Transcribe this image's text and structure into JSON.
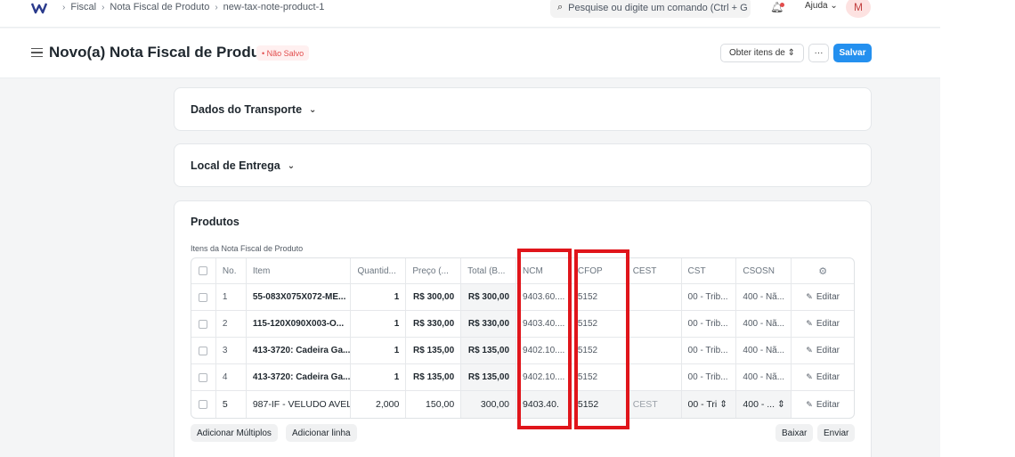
{
  "breadcrumbs": [
    "Fiscal",
    "Nota Fiscal de Produto",
    "new-tax-note-product-1"
  ],
  "search": {
    "placeholder": "Pesquise ou digite um comando (Ctrl + G"
  },
  "navbar": {
    "help_label": "Ajuda",
    "avatar_initial": "M"
  },
  "page": {
    "title": "Novo(a) Nota Fiscal de Produto",
    "status": "Não Salvo",
    "obter_label": "Obter itens de",
    "more_label": "···",
    "save_label": "Salvar"
  },
  "sections": {
    "transporte": "Dados do Transporte",
    "entrega": "Local de Entrega",
    "produtos": "Produtos"
  },
  "grid": {
    "label": "Itens da Nota Fiscal de Produto",
    "columns": [
      "No.",
      "Item",
      "Quantid...",
      "Preço (...",
      "Total (B...",
      "NCM",
      "CFOP",
      "CEST",
      "CST",
      "CSOSN"
    ],
    "edit_label": "Editar",
    "rows": [
      {
        "no": "1",
        "item": "55-083X075X072-ME...",
        "qty": "1",
        "preco": "R$ 300,00",
        "total": "R$ 300,00",
        "ncm": "9403.60....",
        "cfop": "5152",
        "cest": "",
        "cst": "00 - Trib...",
        "csosn": "400 - Nã..."
      },
      {
        "no": "2",
        "item": "115-120X090X003-O...",
        "qty": "1",
        "preco": "R$ 330,00",
        "total": "R$ 330,00",
        "ncm": "9403.40....",
        "cfop": "5152",
        "cest": "",
        "cst": "00 - Trib...",
        "csosn": "400 - Nã..."
      },
      {
        "no": "3",
        "item": "413-3720: Cadeira Ga...",
        "qty": "1",
        "preco": "R$ 135,00",
        "total": "R$ 135,00",
        "ncm": "9402.10....",
        "cfop": "5152",
        "cest": "",
        "cst": "00 - Trib...",
        "csosn": "400 - Nã..."
      },
      {
        "no": "4",
        "item": "413-3720: Cadeira Ga...",
        "qty": "1",
        "preco": "R$ 135,00",
        "total": "R$ 135,00",
        "ncm": "9402.10....",
        "cfop": "5152",
        "cest": "",
        "cst": "00 - Trib...",
        "csosn": "400 - Nã..."
      },
      {
        "no": "5",
        "item": "987-IF - VELUDO AVEL",
        "qty": "2,000",
        "preco": "150,00",
        "total": "300,00",
        "ncm": "9403.40.",
        "cfop": "5152",
        "cest": "CEST",
        "cst": "00 - Tri",
        "csosn": "400 - ..."
      }
    ]
  },
  "footer": {
    "add_multiple": "Adicionar Múltiplos",
    "add_row": "Adicionar linha",
    "download": "Baixar",
    "upload": "Enviar"
  }
}
